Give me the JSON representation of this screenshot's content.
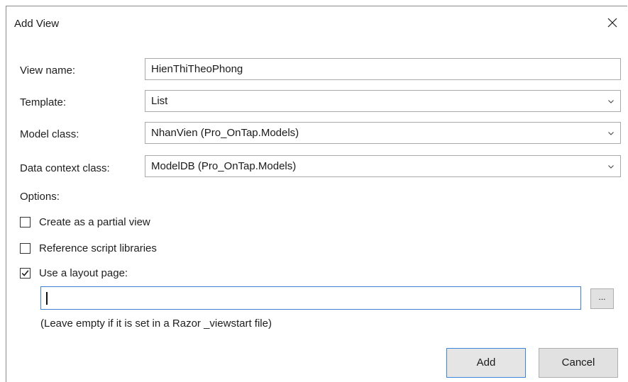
{
  "dialog": {
    "title": "Add View",
    "close_icon": "close-icon"
  },
  "form": {
    "view_name": {
      "label": "View name:",
      "value": "HienThiTheoPhong"
    },
    "template": {
      "label": "Template:",
      "value": "List"
    },
    "model_class": {
      "label": "Model class:",
      "value": "NhanVien (Pro_OnTap.Models)"
    },
    "data_context": {
      "label": "Data context class:",
      "value": "ModelDB (Pro_OnTap.Models)"
    }
  },
  "options": {
    "heading": "Options:",
    "partial_view": {
      "label": "Create as a partial view",
      "checked": false
    },
    "reference_scripts": {
      "label": "Reference script libraries",
      "checked": false
    },
    "use_layout": {
      "label": "Use a layout page:",
      "checked": true
    },
    "layout_path": {
      "value": ""
    },
    "browse_label": "...",
    "hint": "(Leave empty if it is set in a Razor _viewstart file)"
  },
  "buttons": {
    "add": "Add",
    "cancel": "Cancel"
  },
  "colors": {
    "focus_border": "#3c7fd1",
    "button_face": "#e1e1e1"
  }
}
